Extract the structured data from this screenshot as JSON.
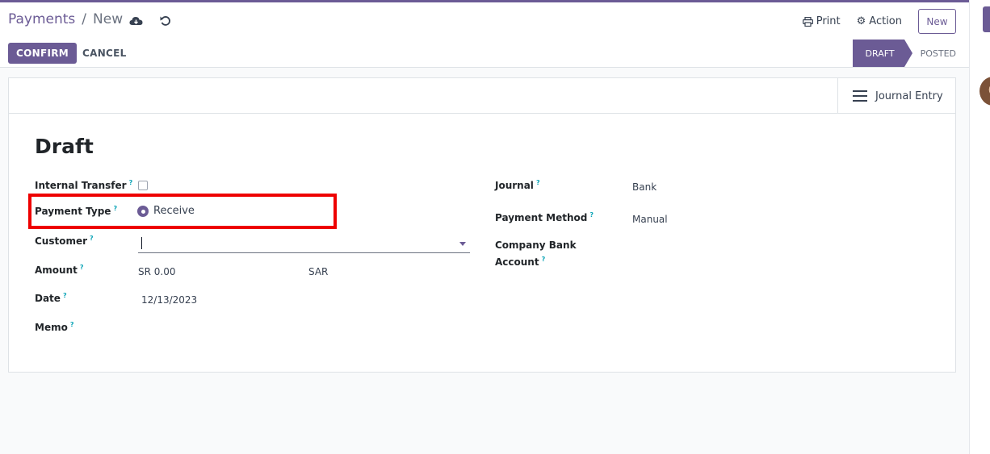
{
  "breadcrumb": {
    "parent": "Payments",
    "separator": "/",
    "current": "New"
  },
  "toolbar": {
    "print_label": "Print",
    "action_label": "Action",
    "new_label": "New",
    "confirm_label": "CONFIRM",
    "cancel_label": "CANCEL"
  },
  "statusbar": {
    "stages": [
      "DRAFT",
      "POSTED"
    ],
    "current": "DRAFT"
  },
  "button_box": {
    "journal_entry_label": "Journal Entry"
  },
  "form": {
    "title": "Draft",
    "help_mark": "?",
    "left": {
      "internal_transfer": {
        "label": "Internal Transfer",
        "checked": false
      },
      "payment_type": {
        "label": "Payment Type",
        "value": "Receive"
      },
      "customer": {
        "label": "Customer",
        "value": ""
      },
      "amount": {
        "label": "Amount",
        "value": "SR 0.00",
        "currency": "SAR"
      },
      "date": {
        "label": "Date",
        "value": "12/13/2023"
      },
      "memo": {
        "label": "Memo",
        "value": ""
      }
    },
    "right": {
      "journal": {
        "label": "Journal",
        "value": "Bank"
      },
      "payment_method": {
        "label": "Payment Method",
        "value": "Manual"
      },
      "company_bank_account": {
        "label_line1": "Company Bank",
        "label_line2": "Account",
        "value": ""
      }
    }
  },
  "colors": {
    "brand": "#6b5b95",
    "highlight": "#ee0000",
    "help": "#0ea5b7"
  },
  "icons": [
    "save-cloud-icon",
    "discard-undo-icon",
    "print-icon",
    "gear-icon",
    "hamburger-menu-icon",
    "dropdown-caret-icon"
  ]
}
